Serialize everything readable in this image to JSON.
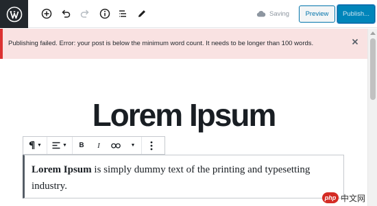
{
  "topbar": {
    "saving_label": "Saving",
    "preview_label": "Preview",
    "publish_label": "Publish..."
  },
  "notice": {
    "message": "Publishing failed. Error: your post is below the minimum word count. It needs to be longer than 100 words.",
    "close_symbol": "×"
  },
  "post": {
    "title": "Lorem Ipsum",
    "paragraph_bold": "Lorem Ipsum",
    "paragraph_rest": " is simply dummy text of the printing and typesetting industry."
  },
  "watermark": {
    "logo_text": "php",
    "site_text": "中文网"
  },
  "colors": {
    "accent": "#0085ba",
    "error": "#dc3232",
    "notice_bg": "#f9e2e2",
    "wp_dark": "#23282d"
  },
  "icons": [
    "wordpress-logo",
    "add-block-icon",
    "undo-icon",
    "redo-icon",
    "info-icon",
    "list-view-icon",
    "edit-tool-icon",
    "cloud-icon",
    "paragraph-icon",
    "align-icon",
    "bold-icon",
    "italic-icon",
    "link-icon",
    "more-options-icon",
    "close-icon"
  ]
}
